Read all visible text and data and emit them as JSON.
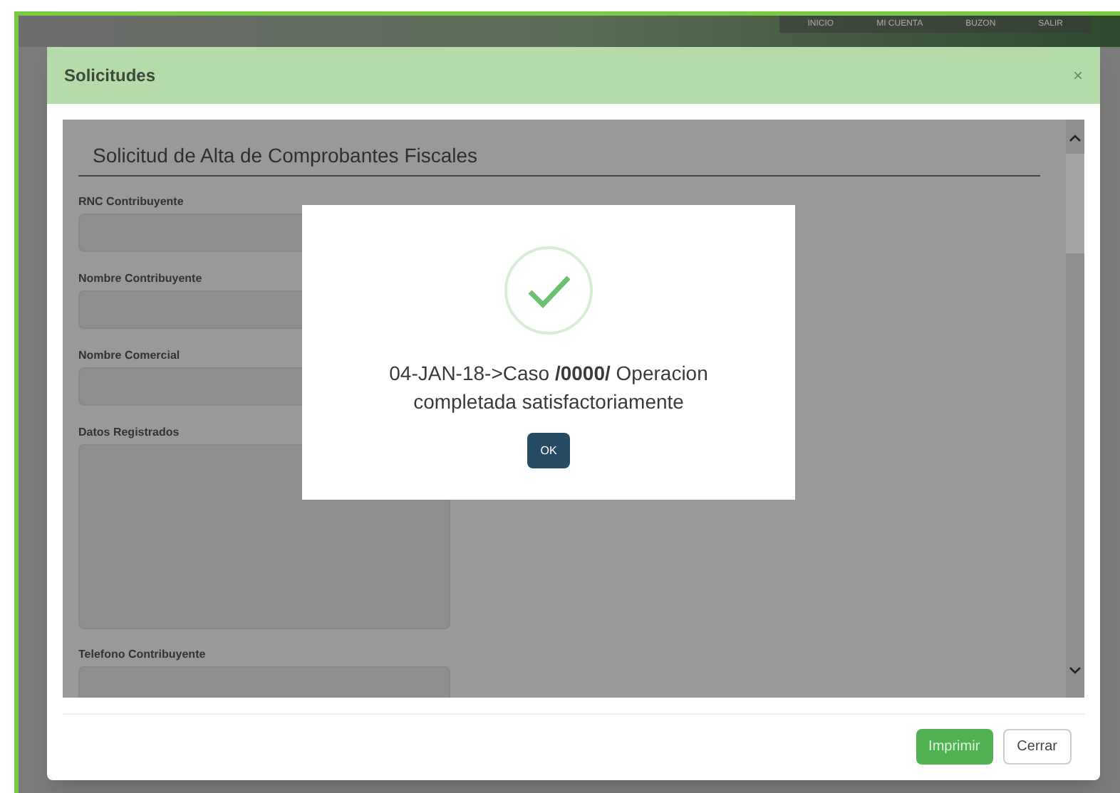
{
  "site_nav": [
    "INICIO",
    "MI CUENTA",
    "BUZON",
    "SALIR"
  ],
  "modal": {
    "title": "Solicitudes",
    "close": "×",
    "form_title": "Solicitud de Alta de Comprobantes Fiscales",
    "fields": [
      {
        "label": "RNC Contribuyente",
        "kind": "input"
      },
      {
        "label": "Nombre Contribuyente",
        "kind": "input"
      },
      {
        "label": "Nombre Comercial",
        "kind": "input"
      },
      {
        "label": "Datos Registrados",
        "kind": "textarea"
      },
      {
        "label": "Telefono Contribuyente",
        "kind": "input"
      }
    ],
    "buttons": [
      {
        "label": "Imprimir",
        "kind": "primary"
      },
      {
        "label": "Cerrar",
        "kind": "default"
      }
    ]
  },
  "alert": {
    "message": "04-JAN-18->Caso **/0000/** Operacion completada satisfactoriamente",
    "button": "OK"
  }
}
